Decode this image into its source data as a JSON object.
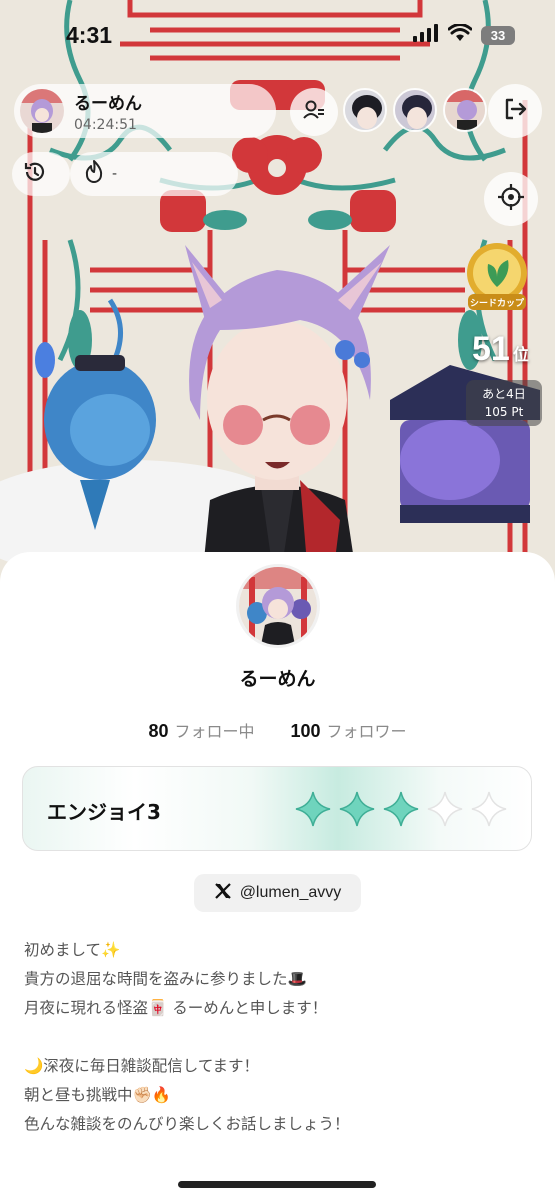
{
  "status_bar": {
    "time": "4:31",
    "battery": "33"
  },
  "host": {
    "name": "るーめん",
    "elapsed": "04:24:51"
  },
  "ranking": {
    "rank": "51",
    "rank_unit": "位",
    "remaining": "あと4日",
    "points": "105 Pt",
    "cup_label": "シードカップ"
  },
  "profile": {
    "name": "るーめん",
    "following_count": "80",
    "following_label": "フォロー中",
    "followers_count": "100",
    "followers_label": "フォロワー",
    "level_label": "エンジョイ3",
    "level_stars_filled": 3,
    "level_stars_total": 5,
    "x_handle": "@lumen_avvy",
    "bio": [
      "初めまして✨",
      "貴方の退屈な時間を盗みに参りました🎩",
      "月夜に現れる怪盗🀄 るーめんと申します！",
      "",
      "🌙深夜に毎日雑談配信してます！",
      "朝と昼も挑戦中✊🏻🔥",
      "色んな雑談をのんびり楽しくお話しましょう！"
    ]
  },
  "colors": {
    "accent_red": "#d2373a",
    "accent_teal": "#3f9c8e",
    "star_teal": "#6fd4bd",
    "cup_gold": "#e2ad2e"
  },
  "icons": [
    "signal-icon",
    "wifi-icon",
    "add-user-icon",
    "exit-icon",
    "history-icon",
    "flame-icon",
    "target-icon",
    "x-logo-icon",
    "diamond-star-icon"
  ]
}
